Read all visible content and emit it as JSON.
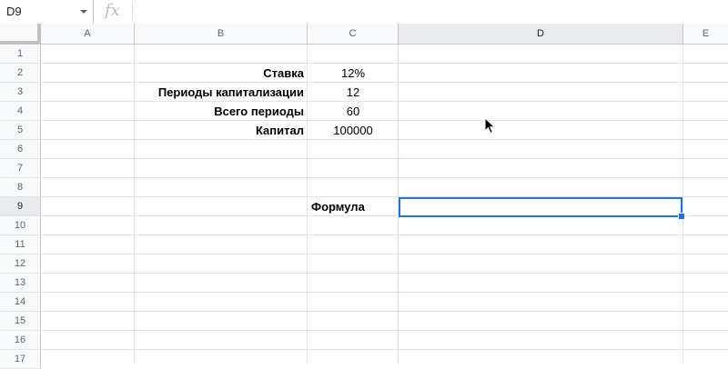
{
  "formula_bar": {
    "cell_ref": "D9",
    "fx_label": "fx",
    "formula": ""
  },
  "columns": [
    "A",
    "B",
    "C",
    "D",
    "E"
  ],
  "selected_column": "D",
  "rows": [
    "1",
    "2",
    "3",
    "4",
    "5",
    "6",
    "7",
    "8",
    "9",
    "10",
    "11",
    "12",
    "13",
    "14",
    "15",
    "16",
    "17"
  ],
  "selected_row": "9",
  "cells": {
    "B2": "Ставка",
    "C2": "12%",
    "B3": "Периоды капитализации",
    "C3": "12",
    "B4": "Всего периоды",
    "C4": "60",
    "B5": "Капитал",
    "C5": "100000",
    "C9": "Формула"
  },
  "colors": {
    "selection": "#1a73e8",
    "header_bg": "#f8f9fa",
    "header_selected_bg": "#e8eaed",
    "gridline": "#e2e3e3"
  }
}
